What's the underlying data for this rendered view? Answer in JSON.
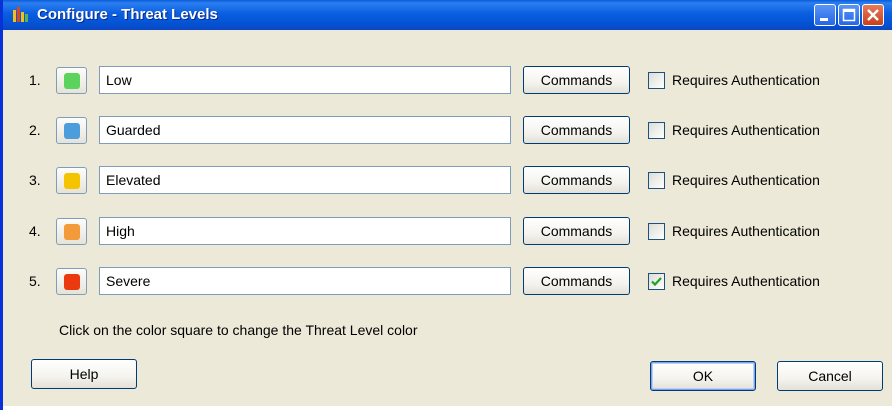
{
  "window": {
    "title": "Configure - Threat Levels",
    "icon": "app-icon",
    "controls": [
      "minimize-icon",
      "maximize-icon",
      "close-icon"
    ]
  },
  "levels": [
    {
      "number": "1.",
      "name": "Low",
      "color": "#5cd35c",
      "commands_label": "Commands",
      "auth_label": "Requires Authentication",
      "requires_auth": false
    },
    {
      "number": "2.",
      "name": "Guarded",
      "color": "#4c9ddb",
      "commands_label": "Commands",
      "auth_label": "Requires Authentication",
      "requires_auth": false
    },
    {
      "number": "3.",
      "name": "Elevated",
      "color": "#f5c400",
      "commands_label": "Commands",
      "auth_label": "Requires Authentication",
      "requires_auth": false
    },
    {
      "number": "4.",
      "name": "High",
      "color": "#f39a3a",
      "commands_label": "Commands",
      "auth_label": "Requires Authentication",
      "requires_auth": false
    },
    {
      "number": "5.",
      "name": "Severe",
      "color": "#ec3a10",
      "commands_label": "Commands",
      "auth_label": "Requires Authentication",
      "requires_auth": true
    }
  ],
  "hint": "Click on the color square to change the Threat Level color",
  "buttons": {
    "help": "Help",
    "ok": "OK",
    "cancel": "Cancel"
  }
}
